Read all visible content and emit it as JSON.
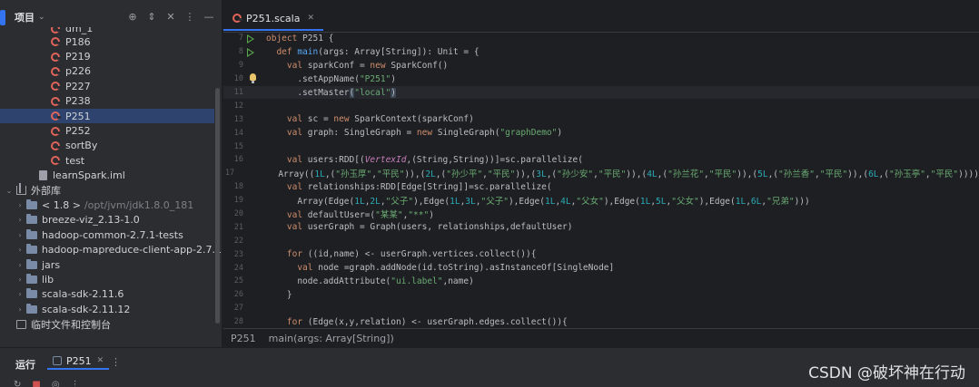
{
  "project": {
    "title": "项目",
    "tools": [
      "⊕",
      "⇕",
      "✕",
      "⋮",
      "—"
    ],
    "tree": [
      {
        "kind": "scala",
        "indent": 56,
        "label": "dm_1",
        "cut": true
      },
      {
        "kind": "scala",
        "indent": 56,
        "label": "P186"
      },
      {
        "kind": "scala",
        "indent": 56,
        "label": "P219"
      },
      {
        "kind": "scala",
        "indent": 56,
        "label": "p226"
      },
      {
        "kind": "scala",
        "indent": 56,
        "label": "P227"
      },
      {
        "kind": "scala",
        "indent": 56,
        "label": "P238"
      },
      {
        "kind": "scala",
        "indent": 56,
        "label": "P251",
        "selected": true
      },
      {
        "kind": "scala",
        "indent": 56,
        "label": "P252"
      },
      {
        "kind": "scala",
        "indent": 56,
        "label": "sortBy"
      },
      {
        "kind": "scala",
        "indent": 56,
        "label": "test"
      },
      {
        "kind": "file",
        "indent": 42,
        "label": "learnSpark.iml"
      },
      {
        "kind": "lib",
        "indent": 18,
        "label": "外部库",
        "arrow": "⌄"
      },
      {
        "kind": "folder",
        "indent": 30,
        "label": "< 1.8 >",
        "extra": "/opt/jvm/jdk1.8.0_181",
        "arrow": "›"
      },
      {
        "kind": "folder",
        "indent": 30,
        "label": "breeze-viz_2.13-1.0",
        "arrow": "›"
      },
      {
        "kind": "folder",
        "indent": 30,
        "label": "hadoop-common-2.7.1-tests",
        "arrow": "›"
      },
      {
        "kind": "folder",
        "indent": 30,
        "label": "hadoop-mapreduce-client-app-2.7.1",
        "arrow": "›"
      },
      {
        "kind": "folder",
        "indent": 30,
        "label": "jars",
        "arrow": "›"
      },
      {
        "kind": "folder",
        "indent": 30,
        "label": "lib",
        "arrow": "›"
      },
      {
        "kind": "folder",
        "indent": 30,
        "label": "scala-sdk-2.11.6",
        "arrow": "›"
      },
      {
        "kind": "folder",
        "indent": 30,
        "label": "scala-sdk-2.11.12",
        "arrow": "›"
      },
      {
        "kind": "console",
        "indent": 18,
        "label": "临时文件和控制台"
      }
    ]
  },
  "editor": {
    "tab_label": "P251.scala",
    "breadcrumb": [
      "P251",
      "main(args: Array[String])"
    ],
    "lines": [
      {
        "n": "7",
        "run": true,
        "html": "<span class='k'>object</span> P251 {"
      },
      {
        "n": "8",
        "run": true,
        "html": "  <span class='k'>def</span> <span class='f'>main</span>(args: Array[String]): Unit = {"
      },
      {
        "n": "9",
        "html": "    <span class='k'>val</span> sparkConf = <span class='k'>new</span> SparkConf()"
      },
      {
        "n": "10",
        "bulb": true,
        "html": "      .setAppName(<span class='s'>\"P251\"</span>)"
      },
      {
        "n": "11",
        "current": true,
        "html": "      .setMaster<span class='hl'>(</span><span class='s'>\"local\"</span><span class='hl'>)</span>"
      },
      {
        "n": "12",
        "html": ""
      },
      {
        "n": "13",
        "html": "    <span class='k'>val</span> sc = <span class='k'>new</span> SparkContext(sparkConf)"
      },
      {
        "n": "14",
        "html": "    <span class='k'>val</span> graph: SingleGraph = <span class='k'>new</span> SingleGraph(<span class='s'>\"graphDemo\"</span>)"
      },
      {
        "n": "15",
        "html": ""
      },
      {
        "n": "16",
        "html": "    <span class='k'>val</span> users:RDD[(<span class='ital'>VertexId</span>,(String,String))]=sc.parallelize("
      },
      {
        "n": "17",
        "html": "      Array((<span class='n'>1L</span>,(<span class='s'>\"孙玉厚\"</span>,<span class='s'>\"平民\"</span>)),(<span class='n'>2L</span>,(<span class='s'>\"孙少平\"</span>,<span class='s'>\"平民\"</span>)),(<span class='n'>3L</span>,(<span class='s'>\"孙少安\"</span>,<span class='s'>\"平民\"</span>)),(<span class='n'>4L</span>,(<span class='s'>\"孙兰花\"</span>,<span class='s'>\"平民\"</span>)),(<span class='n'>5L</span>,(<span class='s'>\"孙兰香\"</span>,<span class='s'>\"平民\"</span>)),(<span class='n'>6L</span>,(<span class='s'>\"孙玉亭\"</span>,<span class='s'>\"平民\"</span>))))"
      },
      {
        "n": "18",
        "html": "    <span class='k'>val</span> relationships:RDD[Edge[String]]=sc.parallelize("
      },
      {
        "n": "19",
        "html": "      Array(Edge(<span class='n'>1L</span>,<span class='n'>2L</span>,<span class='s'>\"父子\"</span>),Edge(<span class='n'>1L</span>,<span class='n'>3L</span>,<span class='s'>\"父子\"</span>),Edge(<span class='n'>1L</span>,<span class='n'>4L</span>,<span class='s'>\"父女\"</span>),Edge(<span class='n'>1L</span>,<span class='n'>5L</span>,<span class='s'>\"父女\"</span>),Edge(<span class='n'>1L</span>,<span class='n'>6L</span>,<span class='s'>\"兄弟\"</span>)))"
      },
      {
        "n": "20",
        "html": "    <span class='k'>val</span> defaultUser=(<span class='s'>\"某某\"</span>,<span class='s'>\"**\"</span>)"
      },
      {
        "n": "21",
        "html": "    <span class='k'>val</span> userGraph = Graph(users, relationships,defaultUser)"
      },
      {
        "n": "22",
        "html": ""
      },
      {
        "n": "23",
        "html": "    <span class='k'>for</span> ((id,name) &lt;- userGraph.vertices.collect()){"
      },
      {
        "n": "24",
        "html": "      <span class='k'>val</span> node =graph.addNode(id.toString).asInstanceOf[SingleNode]"
      },
      {
        "n": "25",
        "html": "      node.addAttribute(<span class='s'>\"ui.label\"</span>,name)"
      },
      {
        "n": "26",
        "html": "    }"
      },
      {
        "n": "27",
        "html": ""
      },
      {
        "n": "28",
        "html": "    <span class='k'>for</span> (Edge(x,y,relation) &lt;- userGraph.edges.collect()){"
      }
    ]
  },
  "run": {
    "title": "运行",
    "tab_label": "P251",
    "more": "⋮",
    "tools": [
      "↻",
      "■",
      "◎",
      "⋮"
    ]
  },
  "watermark": "CSDN @破坏神在行动",
  "colors": {
    "accent": "#3574f0",
    "selected_row": "#2e436e",
    "keyword": "#cf8e6d",
    "string": "#6aab73"
  }
}
